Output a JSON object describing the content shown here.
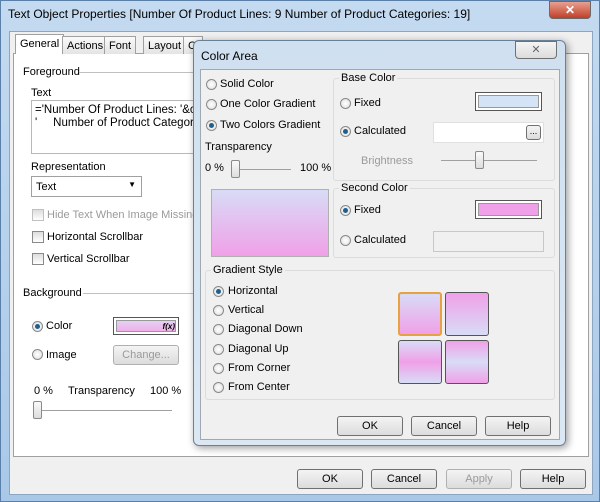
{
  "window": {
    "title": "Text Object Properties [Number Of Product Lines: 9     Number of Product Categories: 19]",
    "close_icon": "close-x"
  },
  "tabs": [
    {
      "label": "General",
      "selected": true
    },
    {
      "label": "Actions"
    },
    {
      "label": "Font"
    },
    {
      "label": "Layout"
    },
    {
      "label": "Caption"
    }
  ],
  "general": {
    "foreground_label": "Foreground",
    "text_label": "Text",
    "text_lines": [
      "='Number Of Product Lines: '&c",
      "'     Number of Product Categor"
    ],
    "representation_label": "Representation",
    "representation_value": "Text",
    "hide_text_label": "Hide Text When Image Missing",
    "horizontal_scrollbar_label": "Horizontal Scrollbar",
    "vertical_scrollbar_label": "Vertical Scrollbar",
    "background_label": "Background",
    "color_label": "Color",
    "color_fx": "f(x)",
    "image_label": "Image",
    "change_label": "Change...",
    "transparency_min": "0 %",
    "transparency_label": "Transparency",
    "transparency_max": "100 %",
    "transparency_value": 0,
    "background_mode": "Color"
  },
  "buttons": {
    "ok": "OK",
    "cancel": "Cancel",
    "apply": "Apply",
    "help": "Help"
  },
  "color_area": {
    "title": "Color Area",
    "mode_options": [
      "Solid Color",
      "One Color Gradient",
      "Two Colors Gradient"
    ],
    "mode_selected": "Two Colors Gradient",
    "transparency_label": "Transparency",
    "transparency_min": "0 %",
    "transparency_max": "100 %",
    "transparency_value": 0,
    "base_color": {
      "label": "Base Color",
      "fixed": "Fixed",
      "calculated": "Calculated",
      "selected": "Calculated",
      "fixed_color": "#d4e4f6",
      "browse": "...",
      "brightness_label": "Brightness",
      "brightness_value": 50
    },
    "second_color": {
      "label": "Second Color",
      "fixed": "Fixed",
      "calculated": "Calculated",
      "selected": "Fixed",
      "fixed_color": "#f0a0e8"
    },
    "gradient_style": {
      "label": "Gradient Style",
      "options": [
        "Horizontal",
        "Vertical",
        "Diagonal Down",
        "Diagonal Up",
        "From Corner",
        "From Center"
      ],
      "selected": "Horizontal"
    },
    "ok": "OK",
    "cancel": "Cancel",
    "help": "Help"
  },
  "colors": {
    "base": "#d8dcf6",
    "second": "#f0a0e8",
    "accent": "#f0b060"
  }
}
